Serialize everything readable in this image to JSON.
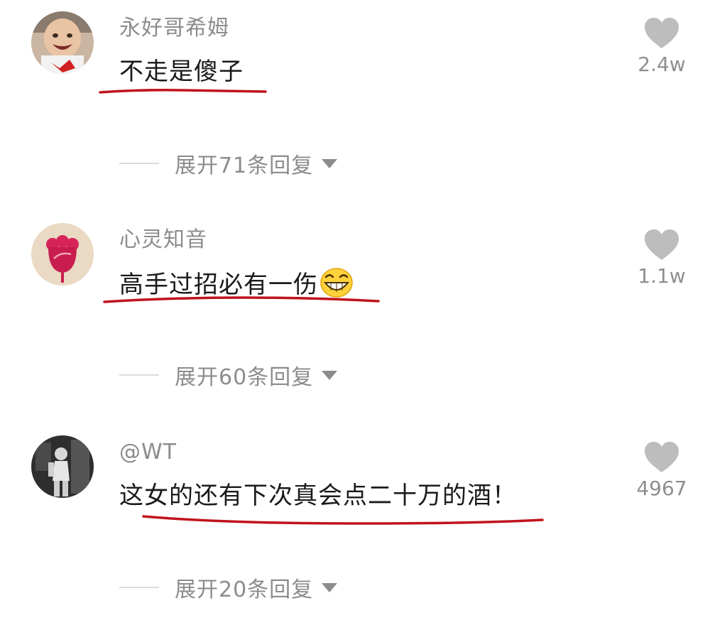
{
  "comments": [
    {
      "username": "永好哥希姆",
      "content": "不走是傻子",
      "likes": "2.4w",
      "replies_label": "展开71条回复",
      "avatar": "baby-photo-avatar",
      "emoji": ""
    },
    {
      "username": "心灵知音",
      "content": "高手过招必有一伤",
      "likes": "1.1w",
      "replies_label": "展开60条回复",
      "avatar": "red-flower-avatar",
      "emoji": "grinning-face-emoji"
    },
    {
      "username": "@WT",
      "content": "这女的还有下次真会点二十万的酒！",
      "likes": "4967",
      "replies_label": "展开20条回复",
      "avatar": "bw-child-photo-avatar",
      "emoji": ""
    }
  ],
  "icons": {
    "like": "heart-icon",
    "expand": "triangle-down-icon"
  },
  "colors": {
    "underline": "#c0131b",
    "meta_text": "#8c8c8c",
    "heart": "#bdbdbd"
  }
}
